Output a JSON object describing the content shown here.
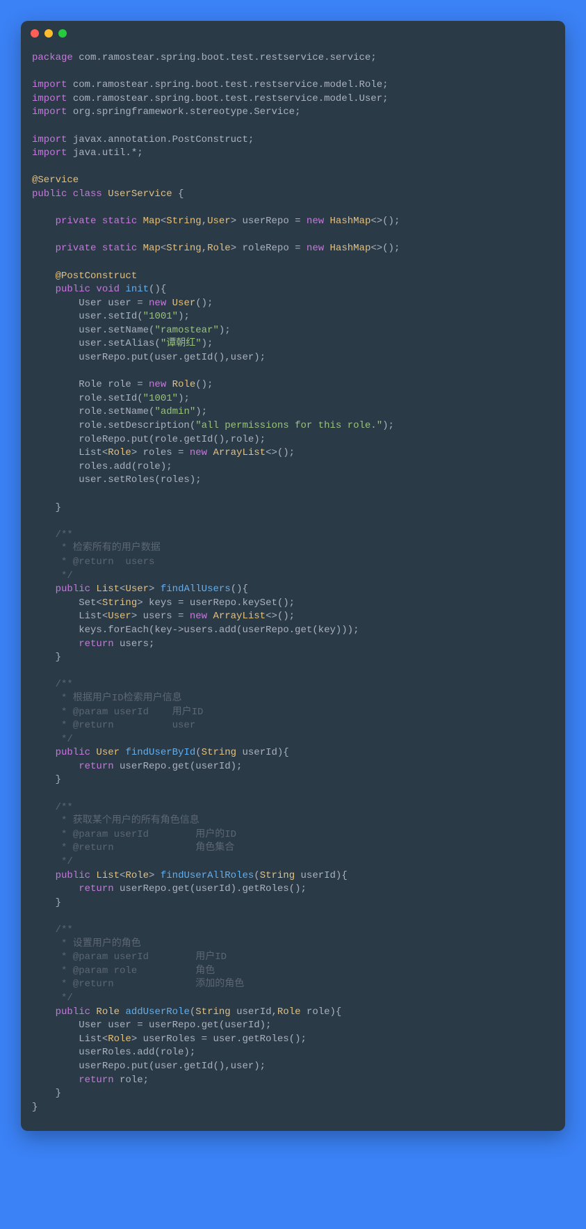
{
  "code": {
    "l1": "package",
    "l1b": " com.ramostear.spring.boot.test.restservice.service;",
    "l3a": "import",
    "l3b": " com.ramostear.spring.boot.test.restservice.model.Role;",
    "l4a": "import",
    "l4b": " com.ramostear.spring.boot.test.restservice.model.User;",
    "l5a": "import",
    "l5b": " org.springframework.stereotype.Service;",
    "l7a": "import",
    "l7b": " javax.annotation.PostConstruct;",
    "l8a": "import",
    "l8b": " java.util.*;",
    "l10": "@Service",
    "l11a": "public class ",
    "l11b": "UserService",
    "l11c": " {",
    "l13a": "    private static ",
    "l13b": "Map",
    "l13c": "<",
    "l13d": "String",
    "l13e": ",",
    "l13f": "User",
    "l13g": "> userRepo = ",
    "l13h": "new ",
    "l13i": "HashMap",
    "l13j": "<>();",
    "l15a": "    private static ",
    "l15b": "Map",
    "l15c": "<",
    "l15d": "String",
    "l15e": ",",
    "l15f": "Role",
    "l15g": "> roleRepo = ",
    "l15h": "new ",
    "l15i": "HashMap",
    "l15j": "<>();",
    "l17": "    @PostConstruct",
    "l18a": "    public ",
    "l18b": "void ",
    "l18c": "init",
    "l18d": "(){",
    "l19a": "        User user = ",
    "l19b": "new ",
    "l19c": "User",
    "l19d": "();",
    "l20a": "        user.setId(",
    "l20b": "\"1001\"",
    "l20c": ");",
    "l21a": "        user.setName(",
    "l21b": "\"ramostear\"",
    "l21c": ");",
    "l22a": "        user.setAlias(",
    "l22b": "\"谭朝红\"",
    "l22c": ");",
    "l23": "        userRepo.put(user.getId(),user);",
    "l25a": "        Role role = ",
    "l25b": "new ",
    "l25c": "Role",
    "l25d": "();",
    "l26a": "        role.setId(",
    "l26b": "\"1001\"",
    "l26c": ");",
    "l27a": "        role.setName(",
    "l27b": "\"admin\"",
    "l27c": ");",
    "l28a": "        role.setDescription(",
    "l28b": "\"all permissions for this role.\"",
    "l28c": ");",
    "l29": "        roleRepo.put(role.getId(),role);",
    "l30a": "        List<",
    "l30b": "Role",
    "l30c": "> roles = ",
    "l30d": "new ",
    "l30e": "ArrayList",
    "l30f": "<>();",
    "l31": "        roles.add(role);",
    "l32": "        user.setRoles(roles);",
    "l34": "    }",
    "l36": "    /**",
    "l37": "     * 检索所有的用户数据",
    "l38": "     * @return  users",
    "l39": "     */",
    "l40a": "    public ",
    "l40b": "List",
    "l40c": "<",
    "l40d": "User",
    "l40e": "> ",
    "l40f": "findAllUsers",
    "l40g": "(){",
    "l41a": "        Set<",
    "l41b": "String",
    "l41c": "> keys = userRepo.keySet();",
    "l42a": "        List<",
    "l42b": "User",
    "l42c": "> users = ",
    "l42d": "new ",
    "l42e": "ArrayList",
    "l42f": "<>();",
    "l43": "        keys.forEach(key->users.add(userRepo.get(key)));",
    "l44a": "        return",
    "l44b": " users;",
    "l45": "    }",
    "l47": "    /**",
    "l48": "     * 根据用户ID检索用户信息",
    "l49": "     * @param userId    用户ID",
    "l50": "     * @return          user",
    "l51": "     */",
    "l52a": "    public ",
    "l52b": "User ",
    "l52c": "findUserById",
    "l52d": "(",
    "l52e": "String",
    "l52f": " userId){",
    "l53a": "        return",
    "l53b": " userRepo.get(userId);",
    "l54": "    }",
    "l56": "    /**",
    "l57": "     * 获取某个用户的所有角色信息",
    "l58": "     * @param userId        用户的ID",
    "l59": "     * @return              角色集合",
    "l60": "     */",
    "l61a": "    public ",
    "l61b": "List",
    "l61c": "<",
    "l61d": "Role",
    "l61e": "> ",
    "l61f": "findUserAllRoles",
    "l61g": "(",
    "l61h": "String",
    "l61i": " userId){",
    "l62a": "        return",
    "l62b": " userRepo.get(userId).getRoles();",
    "l63": "    }",
    "l65": "    /**",
    "l66": "     * 设置用户的角色",
    "l67": "     * @param userId        用户ID",
    "l68": "     * @param role          角色",
    "l69": "     * @return              添加的角色",
    "l70": "     */",
    "l71a": "    public ",
    "l71b": "Role ",
    "l71c": "addUserRole",
    "l71d": "(",
    "l71e": "String",
    "l71f": " userId,",
    "l71g": "Role",
    "l71h": " role){",
    "l72": "        User user = userRepo.get(userId);",
    "l73a": "        List<",
    "l73b": "Role",
    "l73c": "> userRoles = user.getRoles();",
    "l74": "        userRoles.add(role);",
    "l75": "        userRepo.put(user.getId(),user);",
    "l76a": "        return",
    "l76b": " role;",
    "l77": "    }",
    "l78": "}"
  }
}
